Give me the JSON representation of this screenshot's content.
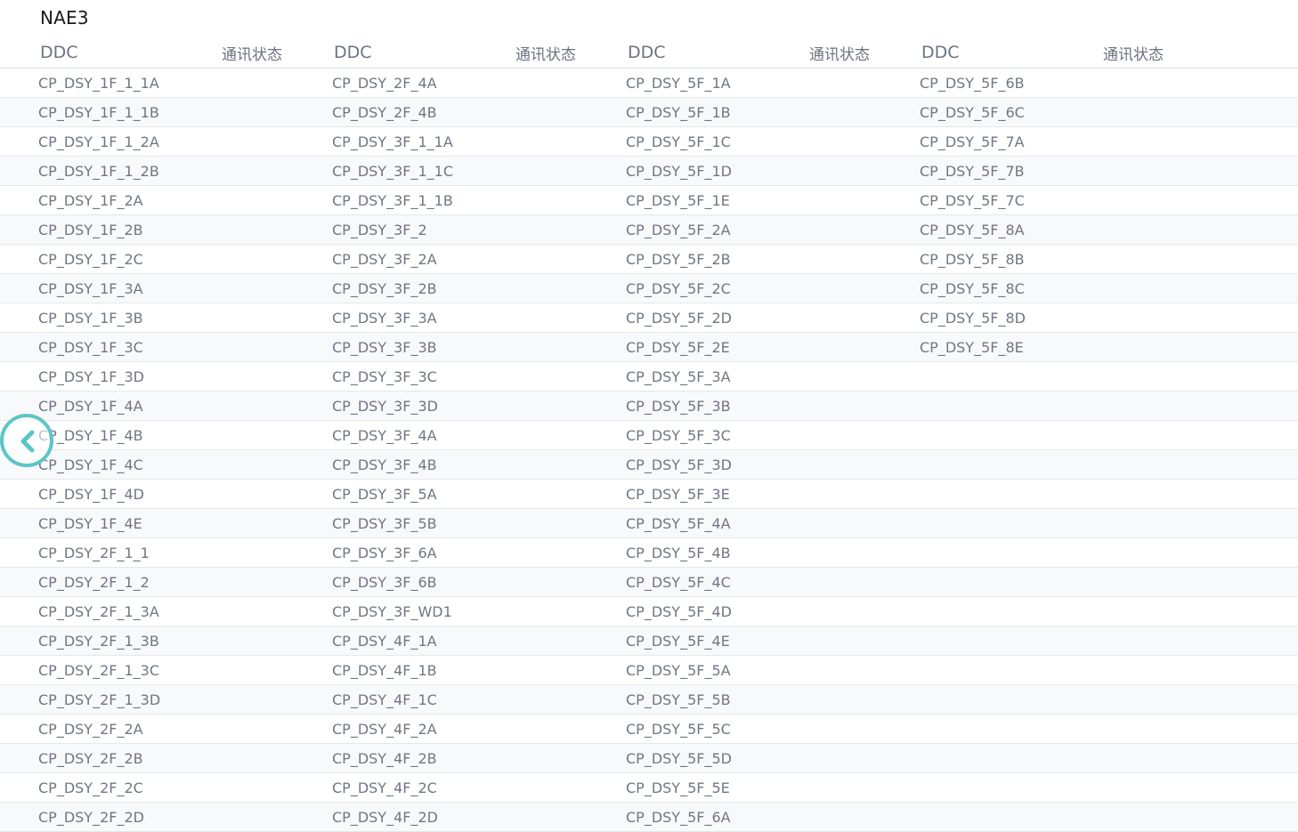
{
  "page": {
    "title": "NAE3"
  },
  "table": {
    "headers": [
      {
        "ddc": "DDC",
        "status": "通讯状态"
      },
      {
        "ddc": "DDC",
        "status": "通讯状态"
      },
      {
        "ddc": "DDC",
        "status": "通讯状态"
      },
      {
        "ddc": "DDC",
        "status": "通讯状态"
      }
    ],
    "rows": [
      [
        "CP_DSY_1F_1_1A",
        "CP_DSY_2F_4A",
        "CP_DSY_5F_1A",
        "CP_DSY_5F_6B"
      ],
      [
        "CP_DSY_1F_1_1B",
        "CP_DSY_2F_4B",
        "CP_DSY_5F_1B",
        "CP_DSY_5F_6C"
      ],
      [
        "CP_DSY_1F_1_2A",
        "CP_DSY_3F_1_1A",
        "CP_DSY_5F_1C",
        "CP_DSY_5F_7A"
      ],
      [
        "CP_DSY_1F_1_2B",
        "CP_DSY_3F_1_1C",
        "CP_DSY_5F_1D",
        "CP_DSY_5F_7B"
      ],
      [
        "CP_DSY_1F_2A",
        "CP_DSY_3F_1_1B",
        "CP_DSY_5F_1E",
        "CP_DSY_5F_7C"
      ],
      [
        "CP_DSY_1F_2B",
        "CP_DSY_3F_2",
        "CP_DSY_5F_2A",
        "CP_DSY_5F_8A"
      ],
      [
        "CP_DSY_1F_2C",
        "CP_DSY_3F_2A",
        "CP_DSY_5F_2B",
        "CP_DSY_5F_8B"
      ],
      [
        "CP_DSY_1F_3A",
        "CP_DSY_3F_2B",
        "CP_DSY_5F_2C",
        "CP_DSY_5F_8C"
      ],
      [
        "CP_DSY_1F_3B",
        "CP_DSY_3F_3A",
        "CP_DSY_5F_2D",
        "CP_DSY_5F_8D"
      ],
      [
        "CP_DSY_1F_3C",
        "CP_DSY_3F_3B",
        "CP_DSY_5F_2E",
        "CP_DSY_5F_8E"
      ],
      [
        "CP_DSY_1F_3D",
        "CP_DSY_3F_3C",
        "CP_DSY_5F_3A",
        ""
      ],
      [
        "CP_DSY_1F_4A",
        "CP_DSY_3F_3D",
        "CP_DSY_5F_3B",
        ""
      ],
      [
        "CP_DSY_1F_4B",
        "CP_DSY_3F_4A",
        "CP_DSY_5F_3C",
        ""
      ],
      [
        "CP_DSY_1F_4C",
        "CP_DSY_3F_4B",
        "CP_DSY_5F_3D",
        ""
      ],
      [
        "CP_DSY_1F_4D",
        "CP_DSY_3F_5A",
        "CP_DSY_5F_3E",
        ""
      ],
      [
        "CP_DSY_1F_4E",
        "CP_DSY_3F_5B",
        "CP_DSY_5F_4A",
        ""
      ],
      [
        "CP_DSY_2F_1_1",
        "CP_DSY_3F_6A",
        "CP_DSY_5F_4B",
        ""
      ],
      [
        "CP_DSY_2F_1_2",
        "CP_DSY_3F_6B",
        "CP_DSY_5F_4C",
        ""
      ],
      [
        "CP_DSY_2F_1_3A",
        "CP_DSY_3F_WD1",
        "CP_DSY_5F_4D",
        ""
      ],
      [
        "CP_DSY_2F_1_3B",
        "CP_DSY_4F_1A",
        "CP_DSY_5F_4E",
        ""
      ],
      [
        "CP_DSY_2F_1_3C",
        "CP_DSY_4F_1B",
        "CP_DSY_5F_5A",
        ""
      ],
      [
        "CP_DSY_2F_1_3D",
        "CP_DSY_4F_1C",
        "CP_DSY_5F_5B",
        ""
      ],
      [
        "CP_DSY_2F_2A",
        "CP_DSY_4F_2A",
        "CP_DSY_5F_5C",
        ""
      ],
      [
        "CP_DSY_2F_2B",
        "CP_DSY_4F_2B",
        "CP_DSY_5F_5D",
        ""
      ],
      [
        "CP_DSY_2F_2C",
        "CP_DSY_4F_2C",
        "CP_DSY_5F_5E",
        ""
      ],
      [
        "CP_DSY_2F_2D",
        "CP_DSY_4F_2D",
        "CP_DSY_5F_6A",
        ""
      ]
    ]
  },
  "back_button": {
    "icon": "chevron-left-icon",
    "color": "#5fc4c7"
  }
}
